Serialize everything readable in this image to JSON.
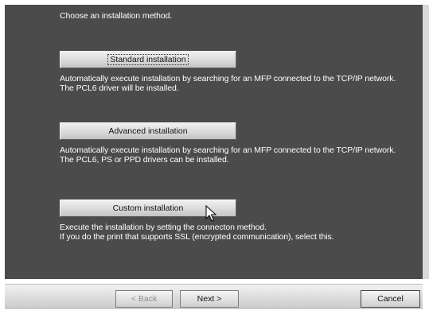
{
  "heading": "Choose an installation method.",
  "options": [
    {
      "label": "Standard installation",
      "description_lines": [
        "Automatically execute installation by searching for an MFP connected to the TCP/IP network.",
        "The PCL6 driver will be installed."
      ]
    },
    {
      "label": "Advanced installation",
      "description_lines": [
        "Automatically execute installation by searching for an MFP connected to the TCP/IP network.",
        "The PCL6, PS or PPD drivers can be installed."
      ]
    },
    {
      "label": "Custom installation",
      "description_lines": [
        "Execute the installation by setting the connecton method.",
        "If you do the print that supports SSL (encrypted communication), select this."
      ]
    }
  ],
  "nav": {
    "back_label": "< Back",
    "next_label": "Next >",
    "cancel_label": "Cancel"
  },
  "icons": {
    "pointer": "mouse-pointer-icon"
  },
  "colors": {
    "panel_bg": "#4b4b4b",
    "text": "#ffffff"
  }
}
